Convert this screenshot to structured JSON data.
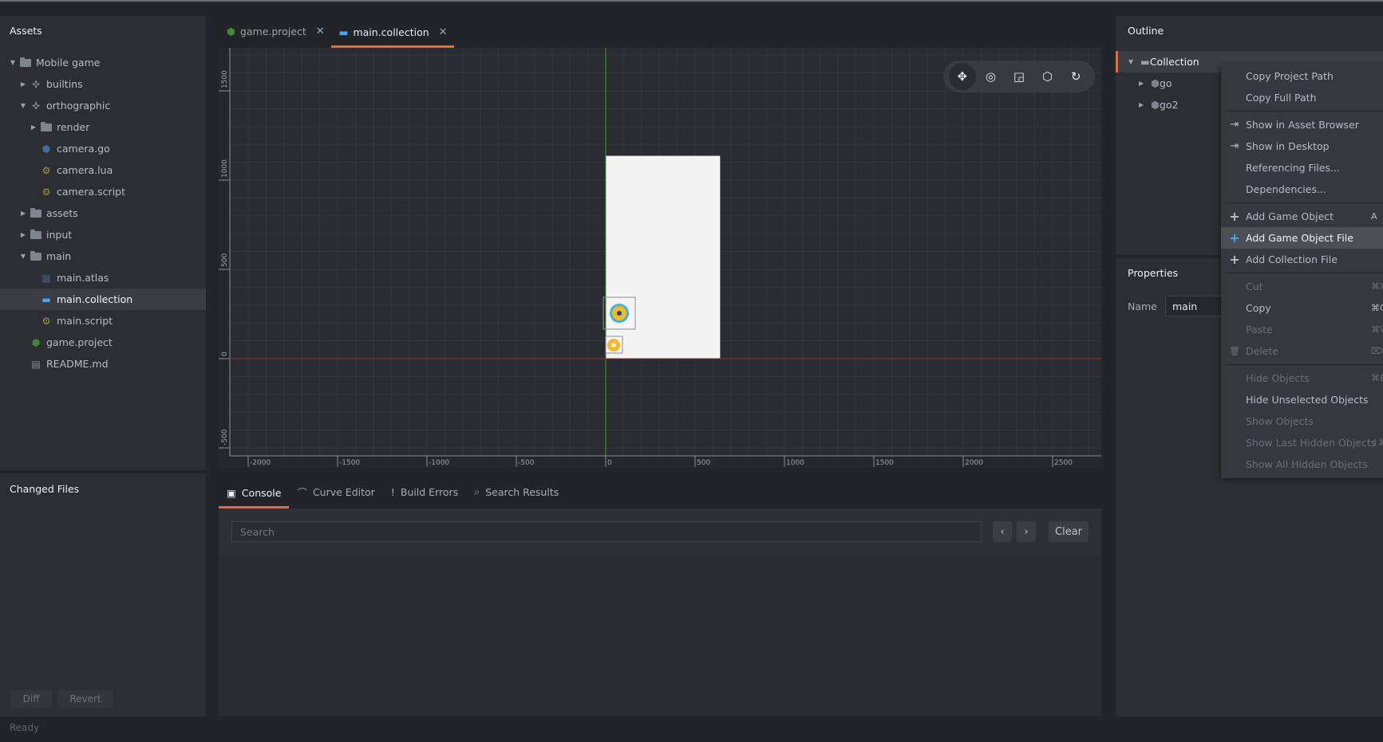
{
  "left_panel": {
    "assets_title": "Assets",
    "tree": [
      {
        "label": "Mobile game",
        "icon": "folder-icon",
        "depth": 0,
        "arrow": "down"
      },
      {
        "label": "builtins",
        "icon": "puzzle-icon",
        "depth": 1,
        "arrow": "right"
      },
      {
        "label": "orthographic",
        "icon": "puzzle-icon",
        "depth": 1,
        "arrow": "down"
      },
      {
        "label": "render",
        "icon": "folder-icon",
        "depth": 2,
        "arrow": "right"
      },
      {
        "label": "camera.go",
        "icon": "game-object-icon",
        "depth": 2,
        "arrow": ""
      },
      {
        "label": "camera.lua",
        "icon": "script-gear-icon",
        "depth": 2,
        "arrow": ""
      },
      {
        "label": "camera.script",
        "icon": "script-gear-icon",
        "depth": 2,
        "arrow": ""
      },
      {
        "label": "assets",
        "icon": "folder-icon",
        "depth": 1,
        "arrow": "right"
      },
      {
        "label": "input",
        "icon": "folder-icon",
        "depth": 1,
        "arrow": "right"
      },
      {
        "label": "main",
        "icon": "folder-icon",
        "depth": 1,
        "arrow": "down"
      },
      {
        "label": "main.atlas",
        "icon": "atlas-icon",
        "depth": 2,
        "arrow": ""
      },
      {
        "label": "main.collection",
        "icon": "collection-icon",
        "depth": 2,
        "arrow": "",
        "selected": true
      },
      {
        "label": "main.script",
        "icon": "script-gear-icon",
        "depth": 2,
        "arrow": ""
      },
      {
        "label": "game.project",
        "icon": "project-icon",
        "depth": 1,
        "arrow": ""
      },
      {
        "label": "README.md",
        "icon": "document-icon",
        "depth": 1,
        "arrow": ""
      }
    ],
    "changed_files_title": "Changed Files",
    "diff_label": "Diff",
    "revert_label": "Revert"
  },
  "status_bar": {
    "text": "Ready"
  },
  "editor_tabs": [
    {
      "label": "game.project",
      "icon": "project-icon",
      "active": false
    },
    {
      "label": "main.collection",
      "icon": "collection-icon",
      "active": true
    }
  ],
  "viewport": {
    "toolbar": [
      "move-tool",
      "rotate-tool",
      "scale-tool",
      "perspective-tool",
      "reset-camera-tool"
    ],
    "x_ticks": [
      "-2000",
      "-1500",
      "-1000",
      "-500",
      "0",
      "500",
      "1000",
      "1500",
      "2000",
      "2500"
    ],
    "y_ticks": [
      "1500",
      "1000",
      "500",
      "0",
      "-500"
    ]
  },
  "bottom_tabs": [
    {
      "label": "Console",
      "icon": "terminal-icon",
      "active": true
    },
    {
      "label": "Curve Editor",
      "icon": "curve-icon",
      "active": false
    },
    {
      "label": "Build Errors",
      "icon": "error-icon",
      "active": false
    },
    {
      "label": "Search Results",
      "icon": "search-icon",
      "active": false
    }
  ],
  "console": {
    "search_placeholder": "Search",
    "prev_label": "‹",
    "next_label": "›",
    "clear_label": "Clear"
  },
  "outline": {
    "title": "Outline",
    "items": [
      {
        "label": "Collection",
        "icon": "collection-icon",
        "selected": true
      },
      {
        "label": "go",
        "icon": "game-object-icon"
      },
      {
        "label": "go2",
        "icon": "game-object-icon"
      }
    ]
  },
  "properties": {
    "title": "Properties",
    "name_label": "Name",
    "name_value": "main"
  },
  "context_menu": {
    "items": [
      {
        "label": "Copy Project Path"
      },
      {
        "label": "Copy Full Path"
      },
      {
        "sep": true
      },
      {
        "label": "Show in Asset Browser",
        "icon": "reveal-icon"
      },
      {
        "label": "Show in Desktop",
        "icon": "reveal-icon"
      },
      {
        "label": "Referencing Files..."
      },
      {
        "label": "Dependencies..."
      },
      {
        "sep": true
      },
      {
        "label": "Add Game Object",
        "icon": "plus-icon",
        "shortcut": "A"
      },
      {
        "label": "Add Game Object File",
        "icon": "plus-icon",
        "hover": true
      },
      {
        "label": "Add Collection File",
        "icon": "plus-icon"
      },
      {
        "sep": true
      },
      {
        "label": "Cut",
        "disabled": true,
        "shortcut": "⌘X"
      },
      {
        "label": "Copy",
        "shortcut": "⌘C"
      },
      {
        "label": "Paste",
        "disabled": true,
        "shortcut": "⌘V"
      },
      {
        "label": "Delete",
        "disabled": true,
        "icon": "trash-icon",
        "shortcut": "⌦"
      },
      {
        "sep": true
      },
      {
        "label": "Hide Objects",
        "disabled": true,
        "shortcut": "⌘E"
      },
      {
        "label": "Hide Unselected Objects"
      },
      {
        "label": "Show Objects",
        "disabled": true
      },
      {
        "label": "Show Last Hidden Objects",
        "disabled": true,
        "shortcut": "⇧⌘E"
      },
      {
        "label": "Show All Hidden Objects",
        "disabled": true
      }
    ]
  },
  "colors": {
    "accent": "#e86a3a",
    "selection_blue": "#4aa8f0",
    "x_axis": "#a0262a",
    "y_axis": "#3f9a2a"
  }
}
